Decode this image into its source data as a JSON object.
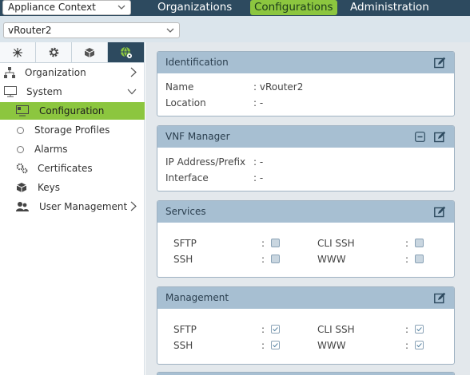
{
  "topbar": {
    "context_select": "Appliance Context",
    "tabs": [
      "Organizations",
      "Configurations",
      "Administration"
    ],
    "active_tab": "Configurations"
  },
  "subbar": {
    "device_select": "vRouter2"
  },
  "sidebar": {
    "items": [
      {
        "label": "Organization",
        "icon": "org-icon"
      },
      {
        "label": "System",
        "icon": "system-icon"
      },
      {
        "label": "Configuration",
        "icon": "configuration-icon"
      },
      {
        "label": "Storage Profiles",
        "icon": "radio-icon"
      },
      {
        "label": "Alarms",
        "icon": "radio-icon"
      },
      {
        "label": "Certificates",
        "icon": "certificates-icon"
      },
      {
        "label": "Keys",
        "icon": "keys-icon"
      },
      {
        "label": "User Management",
        "icon": "users-icon"
      }
    ]
  },
  "panels": {
    "identification": {
      "title": "Identification",
      "rows": [
        {
          "label": "Name",
          "value": ": vRouter2"
        },
        {
          "label": "Location",
          "value": ": -"
        }
      ]
    },
    "vnf": {
      "title": "VNF Manager",
      "rows": [
        {
          "label": "IP Address/Prefix",
          "value": ": -"
        },
        {
          "label": "Interface",
          "value": ": -"
        }
      ]
    },
    "services": {
      "title": "Services",
      "sep": ":",
      "items": [
        {
          "label": "SFTP",
          "checked": false
        },
        {
          "label": "CLI SSH",
          "checked": false
        },
        {
          "label": "SSH",
          "checked": false
        },
        {
          "label": "WWW",
          "checked": false
        }
      ]
    },
    "management": {
      "title": "Management",
      "sep": ":",
      "items": [
        {
          "label": "SFTP",
          "checked": true
        },
        {
          "label": "CLI SSH",
          "checked": true
        },
        {
          "label": "SSH",
          "checked": true
        },
        {
          "label": "WWW",
          "checked": true
        }
      ]
    }
  },
  "colors": {
    "nav": "#2d4a5f",
    "accent": "#8cc63f",
    "panel_head": "#a7bfd2"
  }
}
